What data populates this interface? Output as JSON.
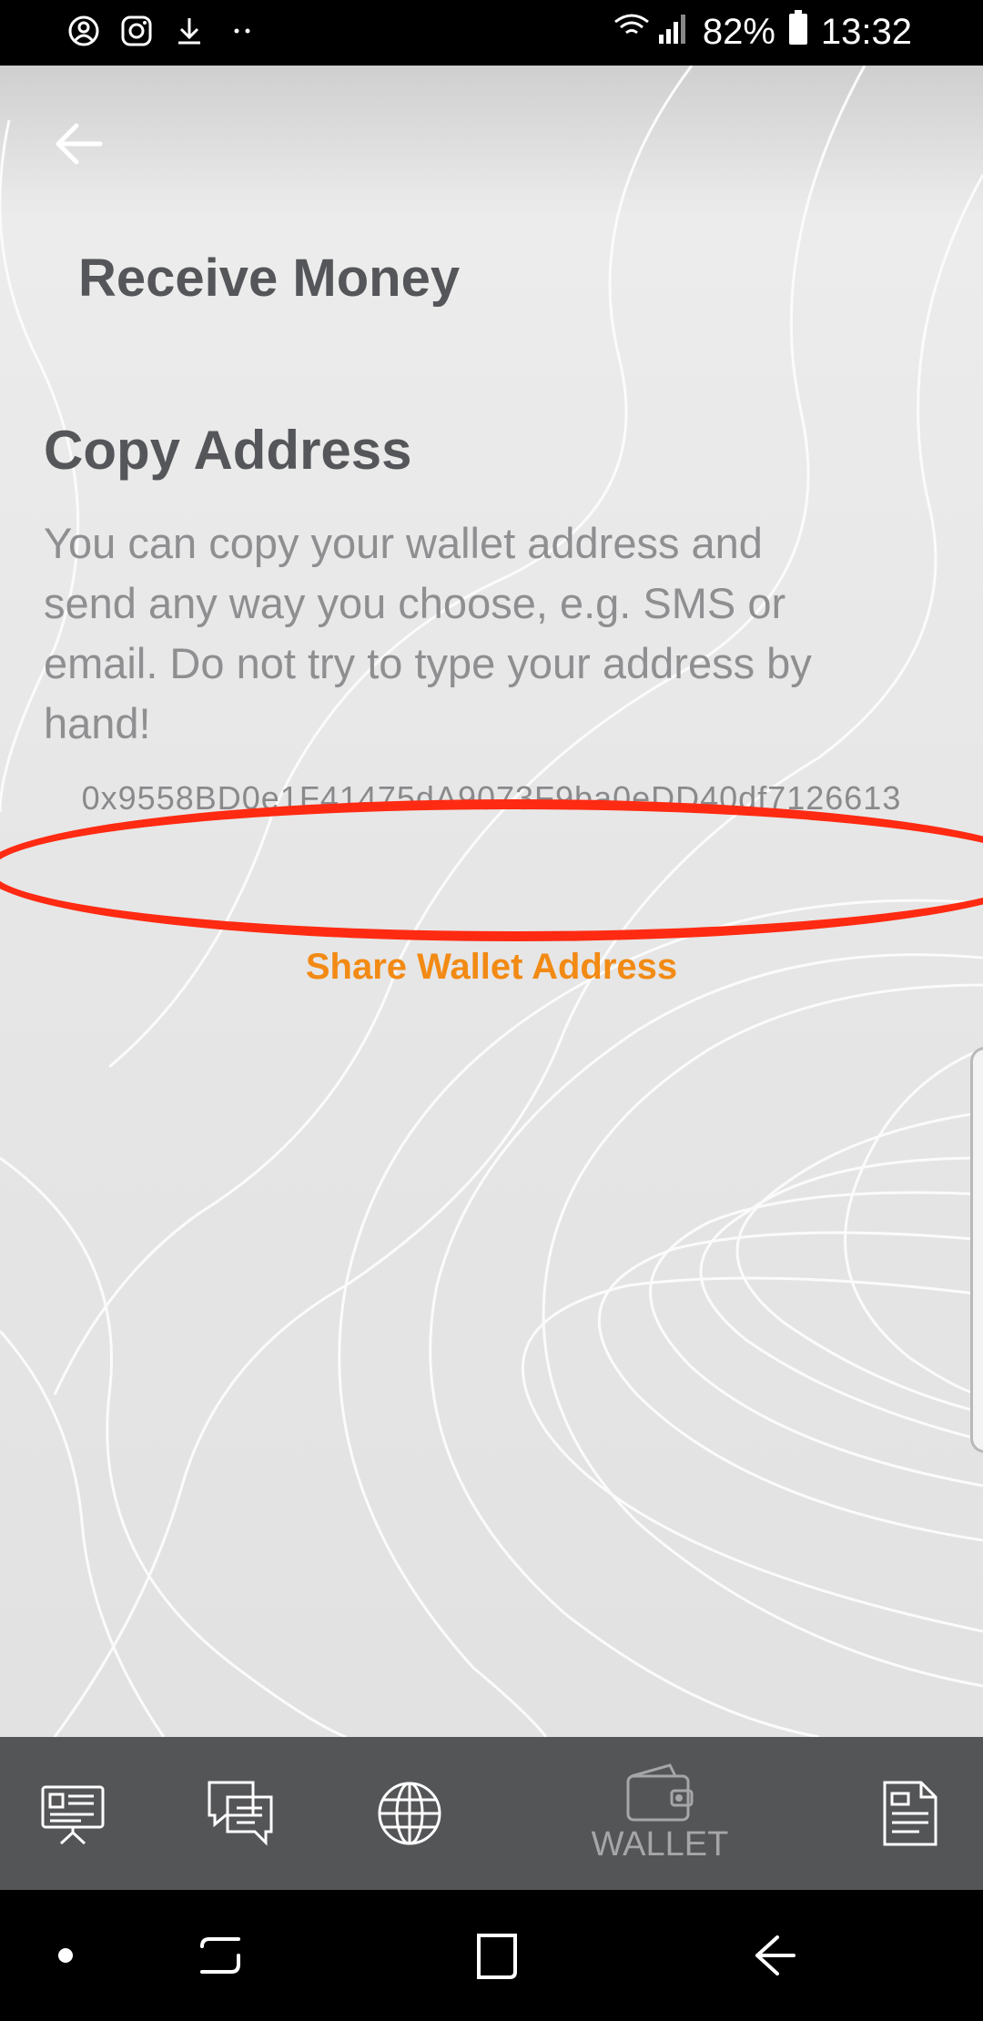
{
  "status_bar": {
    "battery": "82%",
    "time": "13:32",
    "left_icons": [
      "account-circle-icon",
      "instagram-icon",
      "download-icon",
      "more-dots-icon"
    ]
  },
  "header": {
    "back_icon": "arrow-left-icon",
    "title": "Receive Money"
  },
  "copy_section": {
    "title": "Copy Address",
    "description": "You can copy your wallet address and send any way you choose, e.g. SMS or email. Do not try to type your address by hand!",
    "wallet_address": "0x9558BD0e1F41475dA9073F9ba0eDD40df7126613",
    "share_label": "Share Wallet Address"
  },
  "bottom_nav": {
    "items": [
      {
        "icon": "presentation-icon",
        "label": ""
      },
      {
        "icon": "chat-bubbles-icon",
        "label": ""
      },
      {
        "icon": "globe-icon",
        "label": ""
      },
      {
        "icon": "wallet-icon",
        "label": "WALLET"
      },
      {
        "icon": "document-icon",
        "label": ""
      }
    ]
  },
  "colors": {
    "accent": "#f28a14",
    "annotation": "#ff2a12",
    "nav_bg": "#545557",
    "title_text": "#555659"
  }
}
